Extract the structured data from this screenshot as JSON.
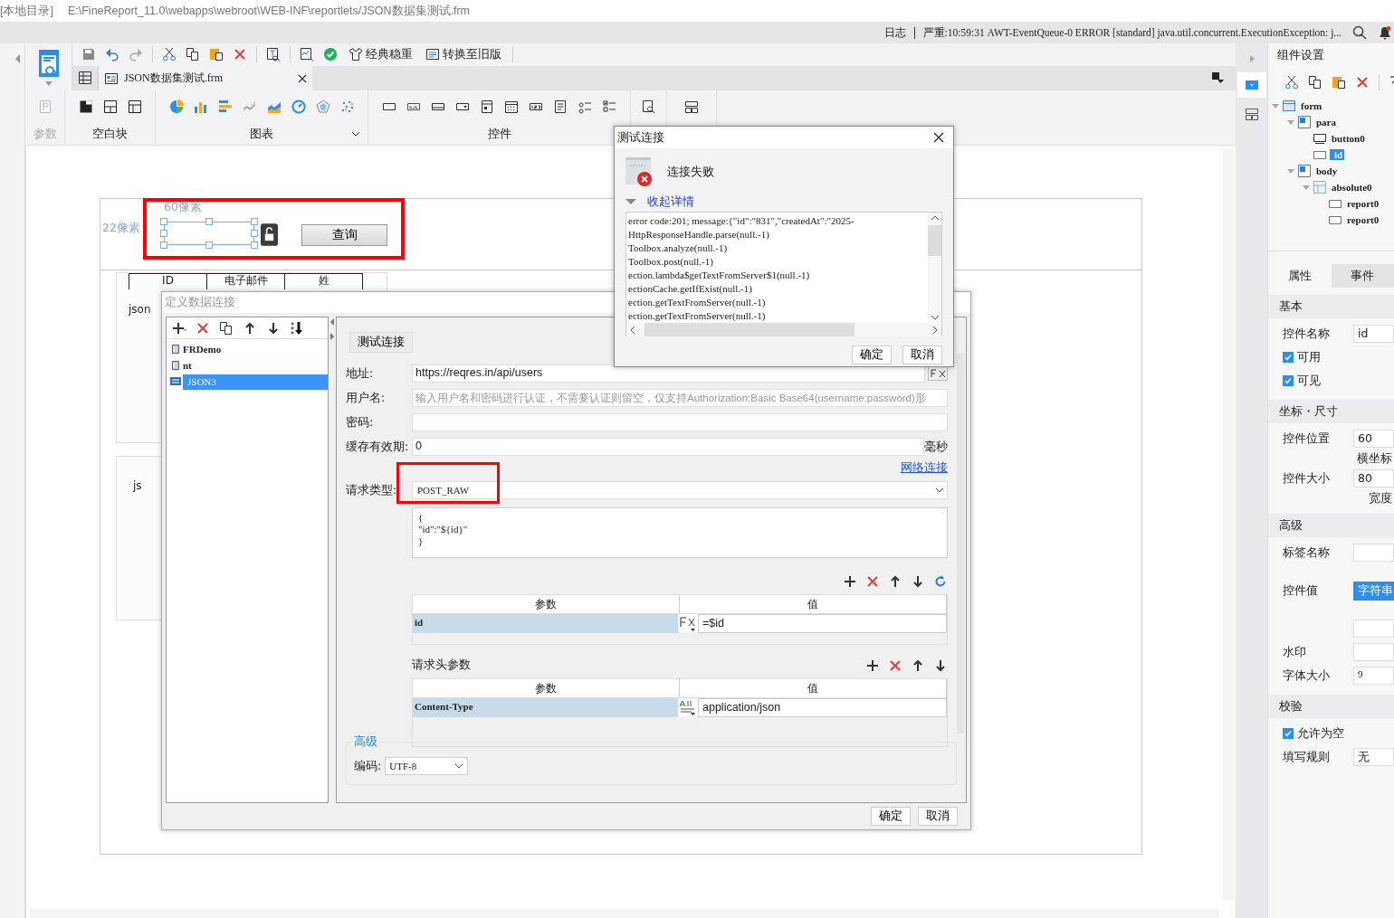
{
  "title_bar": {
    "location": "[本地目录]",
    "path": "E:\\FineReport_11.0\\webapps\\webroot\\WEB-INF\\reportlets/JSON数据集测试.frm"
  },
  "log_bar": {
    "label": "日志",
    "message": "严重:10:59:31 AWT-EventQueue-0 ERROR [standard] java.util.concurrent.ExecutionException: j..."
  },
  "toolbar": {
    "buttons": [
      {
        "label": "经典稳重",
        "kind": "theme"
      },
      {
        "label": "转换至旧版",
        "kind": "convert"
      }
    ]
  },
  "tabs": [
    {
      "label": "JSON数据集测试.frm",
      "selected": true
    }
  ],
  "palette": [
    {
      "label": "参数",
      "kind": "param",
      "disabled": true
    },
    {
      "label": "空白块",
      "kind": "blocks",
      "disabled": false
    },
    {
      "label": "图表",
      "kind": "charts",
      "disabled": false
    },
    {
      "label": "控件",
      "kind": "widgets",
      "disabled": false
    }
  ],
  "canvas": {
    "width_hint": "60像素",
    "height_hint": "22像素",
    "query_button": "查询",
    "table_headers": [
      "ID",
      "电子邮件",
      "姓"
    ],
    "cells": [
      "json",
      "js"
    ]
  },
  "data_dialog": {
    "title": "定义数据连接",
    "connections": [
      {
        "name": "FRDemo",
        "kind": "db",
        "selected": false
      },
      {
        "name": "nt",
        "kind": "db",
        "selected": false
      },
      {
        "name": "JSON3",
        "kind": "json",
        "selected": true
      }
    ],
    "test_button": "测试连接",
    "address": {
      "label": "地址:",
      "value": "https://reqres.in/api/users"
    },
    "username": {
      "label": "用户名:",
      "placeholder": "输入用户名和密码进行认证，不需要认证则留空，仅支持Authorization:Basic Base64(username:password)形"
    },
    "password": {
      "label": "密码:"
    },
    "cache": {
      "label": "缓存有效期:",
      "value": "0",
      "unit": "毫秒"
    },
    "network_link": "网络连接",
    "request_type": {
      "label": "请求类型:",
      "value": "POST_RAW"
    },
    "body_lines": [
      "{",
      "\"id\":\"${id}\"",
      "}"
    ],
    "params": {
      "columns": [
        "参数",
        "值"
      ],
      "rows": [
        {
          "name": "id",
          "value": "=$id",
          "kind": "formula"
        }
      ]
    },
    "headers": {
      "label": "请求头参数",
      "columns": [
        "参数",
        "值"
      ],
      "rows": [
        {
          "name": "Content-Type",
          "value": "application/json",
          "kind": "text"
        }
      ]
    },
    "advanced": {
      "label": "高级",
      "encoding_label": "编码:",
      "encoding": "UTF-8"
    },
    "buttons": [
      "确定",
      "取消"
    ]
  },
  "test_dialog": {
    "title": "测试连接",
    "status": "连接失败",
    "details_toggle": "收起详情",
    "expanded": true,
    "details": [
      "error code:201; message:{\"id\":\"831\",\"createdAt\":\"2025-",
      "HttpResponseHandle.parse(null.-1)",
      "Toolbox.analyze(null.-1)",
      "Toolbox.post(null.-1)",
      "ection.lambda$getTextFromServer$1(null.-1)",
      "ectionCache.getIfExist(null.-1)",
      "ection.getTextFromServer(null.-1)",
      "ection.getTextFromServer(null.-1)"
    ],
    "buttons": [
      "确定",
      "取消"
    ]
  },
  "component_settings": {
    "title": "组件设置",
    "tree": [
      {
        "name": "form",
        "kind": "form",
        "selected": false,
        "expanded": true,
        "children": [
          {
            "name": "para",
            "kind": "container",
            "selected": false,
            "expanded": true,
            "children": [
              {
                "name": "button0",
                "kind": "button",
                "selected": false
              },
              {
                "name": "id",
                "kind": "widget",
                "selected": true
              }
            ]
          },
          {
            "name": "body",
            "kind": "container",
            "selected": false,
            "expanded": true,
            "children": [
              {
                "name": "absolute0",
                "kind": "layout",
                "selected": false,
                "expanded": true,
                "children": [
                  {
                    "name": "report0",
                    "kind": "widget",
                    "selected": false
                  },
                  {
                    "name": "report0",
                    "kind": "widget",
                    "selected": false
                  }
                ]
              }
            ]
          }
        ]
      }
    ],
    "tabs": [
      {
        "label": "属性",
        "selected": true
      },
      {
        "label": "事件",
        "selected": false
      }
    ],
    "sections": [
      {
        "title": "基本",
        "items": [
          {
            "kind": "text",
            "label": "控件名称",
            "value": "id"
          },
          {
            "kind": "check",
            "label": "可用",
            "checked": true
          },
          {
            "kind": "check",
            "label": "可见",
            "checked": true
          }
        ]
      },
      {
        "title": "坐标・尺寸",
        "items": [
          {
            "kind": "number",
            "label": "控件位置",
            "value": "60",
            "caption": "横坐标"
          },
          {
            "kind": "number",
            "label": "控件大小",
            "value": "80",
            "caption": "宽度"
          }
        ]
      },
      {
        "title": "高级",
        "items": [
          {
            "kind": "text",
            "label": "标签名称"
          },
          {
            "kind": "typed",
            "label": "控件值",
            "type_button": "字符串"
          },
          {
            "kind": "text",
            "label": "水印"
          },
          {
            "kind": "text",
            "label": "字体大小",
            "value": "9"
          }
        ]
      },
      {
        "title": "校验",
        "items": [
          {
            "kind": "check",
            "label": "允许为空",
            "checked": true
          },
          {
            "kind": "select",
            "label": "填写规则",
            "value": "无"
          }
        ]
      }
    ]
  }
}
